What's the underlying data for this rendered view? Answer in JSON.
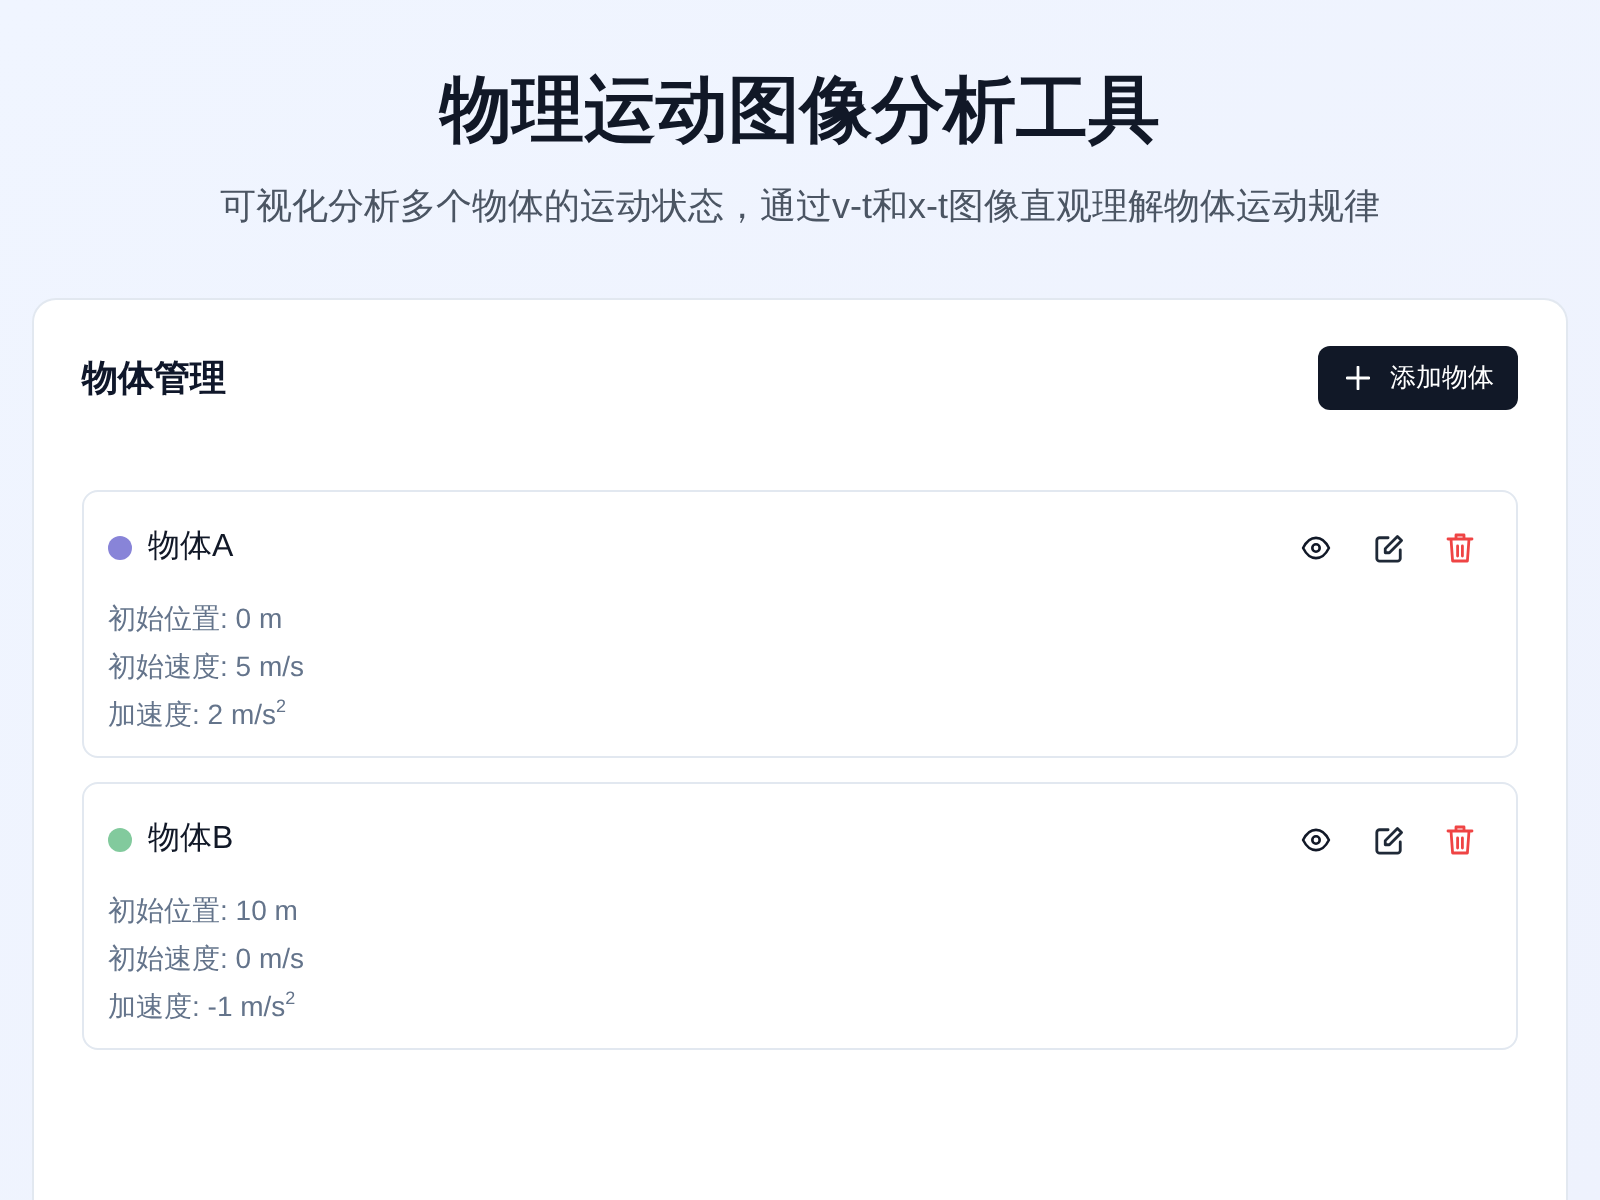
{
  "header": {
    "title": "物理运动图像分析工具",
    "subtitle": "可视化分析多个物体的运动状态，通过v-t和x-t图像直观理解物体运动规律"
  },
  "panel": {
    "title": "物体管理",
    "add_button": {
      "label": "添加物体"
    }
  },
  "objects": [
    {
      "name": "物体A",
      "color": "#8884d8",
      "details": [
        "初始位置: 0 m",
        "初始速度: 5 m/s",
        "加速度: 2 m/s$^{2}$"
      ]
    },
    {
      "name": "物体B",
      "color": "#82ca9d",
      "details": [
        "初始位置: 10 m",
        "初始速度: 0 m/s",
        "加速度: -1 m/s$^{2}$"
      ]
    }
  ]
}
